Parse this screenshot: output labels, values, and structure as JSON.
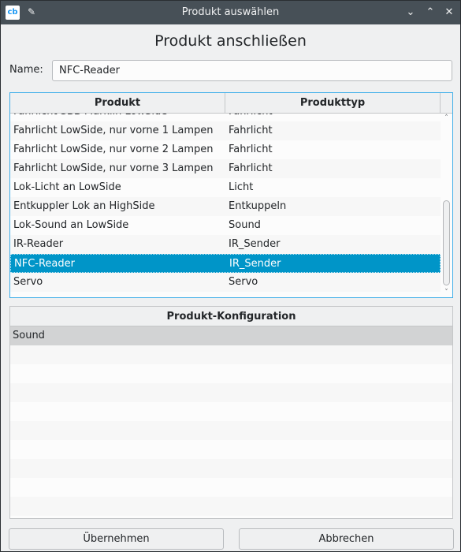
{
  "window": {
    "title": "Produkt auswählen",
    "logo_text": "cb",
    "pin_glyph": "✎",
    "minimize_glyph": "⌄",
    "maximize_glyph": "⌃",
    "close_glyph": "✕"
  },
  "heading": "Produkt anschließen",
  "name_field": {
    "label": "Name:",
    "value": "NFC-Reader"
  },
  "product_table": {
    "columns": [
      "Produkt",
      "Produkttyp"
    ],
    "rows": [
      {
        "produkt": "Fahrlicht SBB Märklin LowSide",
        "typ": "Fahrlicht"
      },
      {
        "produkt": "Fahrlicht LowSide, nur vorne 1 Lampen",
        "typ": "Fahrlicht"
      },
      {
        "produkt": "Fahrlicht LowSide, nur vorne 2 Lampen",
        "typ": "Fahrlicht"
      },
      {
        "produkt": "Fahrlicht LowSide, nur vorne 3 Lampen",
        "typ": "Fahrlicht"
      },
      {
        "produkt": "Lok-Licht an LowSide",
        "typ": "Licht"
      },
      {
        "produkt": "Entkuppler Lok an HighSide",
        "typ": "Entkuppeln"
      },
      {
        "produkt": "Lok-Sound an LowSide",
        "typ": "Sound"
      },
      {
        "produkt": "IR-Reader",
        "typ": "IR_Sender"
      },
      {
        "produkt": "NFC-Reader",
        "typ": "IR_Sender",
        "selected": true
      },
      {
        "produkt": "Servo",
        "typ": "Servo"
      }
    ],
    "scroll_up_glyph": "˄",
    "scroll_down_glyph": "˅"
  },
  "config_table": {
    "header": "Produkt-Konfiguration",
    "rows": [
      "Sound",
      "",
      "",
      "",
      "",
      "",
      "",
      "",
      "",
      ""
    ]
  },
  "buttons": {
    "ok": "Übernehmen",
    "cancel": "Abbrechen"
  },
  "colors": {
    "titlebar": "#475057",
    "selection": "#0095c8",
    "focus_border": "#3daee9",
    "background": "#eff0f1"
  }
}
